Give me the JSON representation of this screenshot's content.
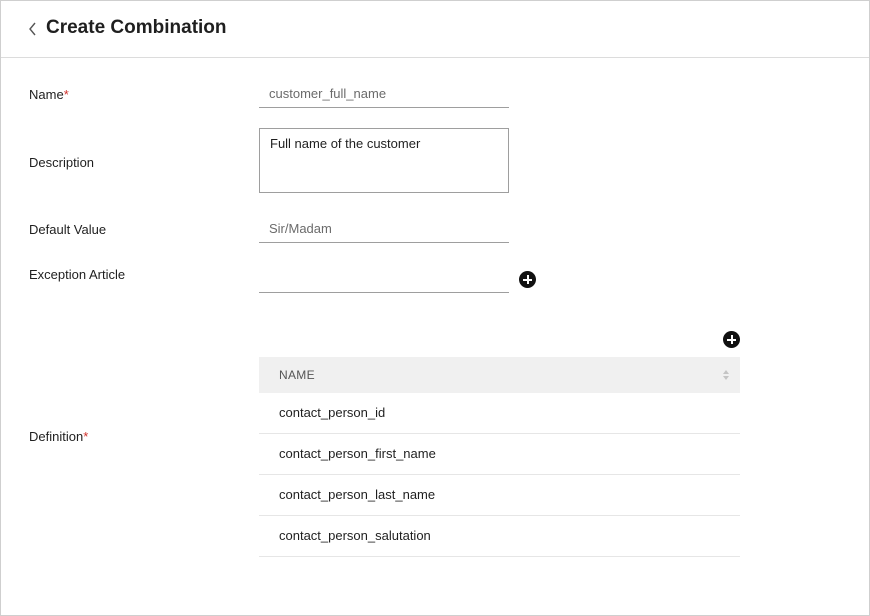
{
  "header": {
    "title": "Create Combination",
    "back_icon": "chevron-left-icon"
  },
  "form": {
    "name": {
      "label": "Name",
      "required_mark": "*",
      "value": "customer_full_name"
    },
    "description": {
      "label": "Description",
      "value": "Full name of the customer"
    },
    "default_value": {
      "label": "Default Value",
      "value": "Sir/Madam"
    },
    "exception_article": {
      "label": "Exception Article",
      "value": "",
      "add_icon": "plus-circle-icon"
    },
    "definition": {
      "label": "Definition",
      "required_mark": "*",
      "add_icon": "plus-circle-icon",
      "table": {
        "column": "NAME",
        "sort_icon": "sort-icon",
        "rows": [
          "contact_person_id",
          "contact_person_first_name",
          "contact_person_last_name",
          "contact_person_salutation"
        ]
      }
    }
  }
}
